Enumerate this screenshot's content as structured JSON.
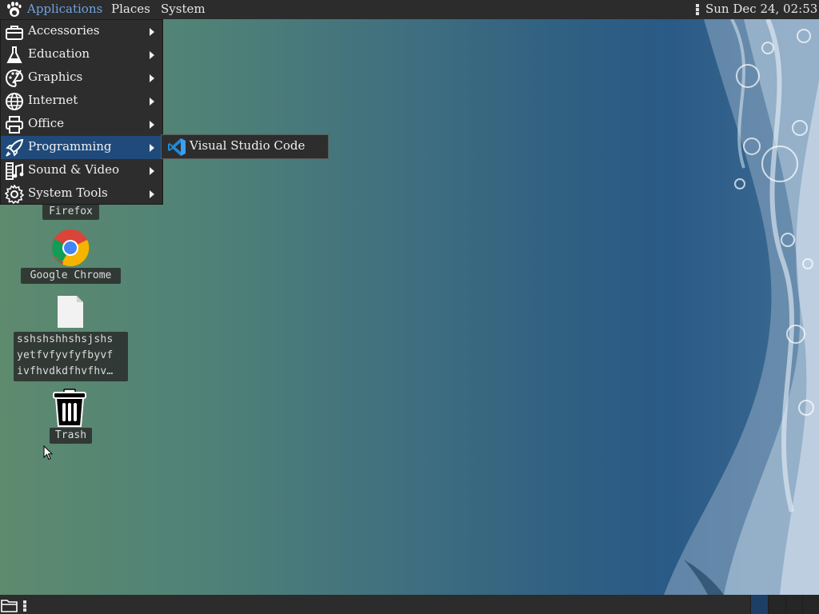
{
  "top_panel": {
    "menus": {
      "applications": "Applications",
      "places": "Places",
      "system": "System"
    },
    "clock": "Sun Dec 24, 02:53"
  },
  "applications_menu": {
    "items": [
      {
        "label": "Accessories",
        "icon": "toolbox-icon"
      },
      {
        "label": "Education",
        "icon": "flask-icon"
      },
      {
        "label": "Graphics",
        "icon": "palette-icon"
      },
      {
        "label": "Internet",
        "icon": "globe-icon"
      },
      {
        "label": "Office",
        "icon": "printer-icon"
      },
      {
        "label": "Programming",
        "icon": "rocket-icon",
        "active": true
      },
      {
        "label": "Sound & Video",
        "icon": "media-icon"
      },
      {
        "label": "System Tools",
        "icon": "gear-icon"
      }
    ],
    "submenu": {
      "items": [
        {
          "label": "Visual Studio Code",
          "icon": "vscode-icon"
        }
      ]
    }
  },
  "desktop": {
    "icons": [
      {
        "label": "Firefox"
      },
      {
        "label": "Google Chrome"
      },
      {
        "label_lines": [
          "sshshshhshsjshs",
          "yetfvfyvfyfbyvf",
          "ivfhvdkdfhvfhv…"
        ]
      },
      {
        "label": "Trash"
      }
    ]
  },
  "colors": {
    "panel": "#2c2c2c",
    "menu_bg": "#2d2d2d",
    "menu_active": "#1f4a7a",
    "applications_text": "#6ea3e0"
  }
}
